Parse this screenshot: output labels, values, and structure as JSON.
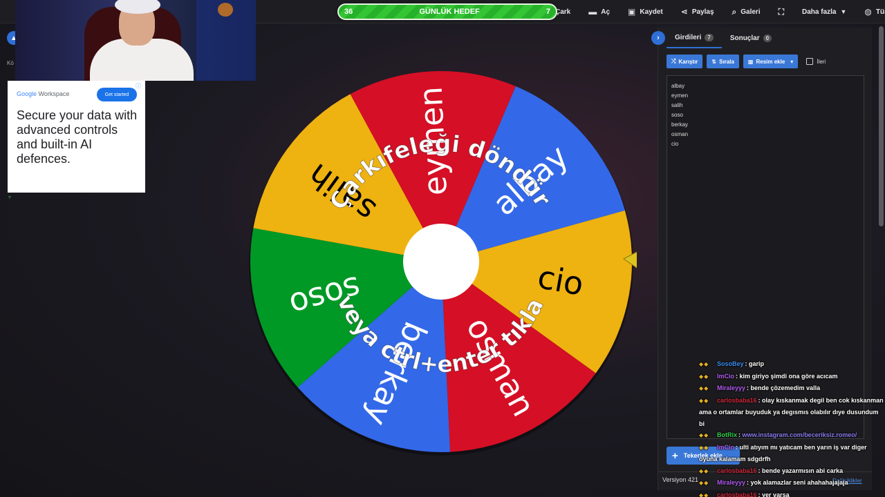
{
  "goal": {
    "left": "36",
    "label": "GÜNLÜK HEDEF",
    "right": "7"
  },
  "nav": [
    {
      "label": "Çark",
      "icon": "wheel-icon",
      "glyph": ""
    },
    {
      "label": "Aç",
      "icon": "folder-icon",
      "glyph": "▬"
    },
    {
      "label": "Kaydet",
      "icon": "save-icon",
      "glyph": "▣"
    },
    {
      "label": "Paylaş",
      "icon": "share-icon",
      "glyph": "⋖"
    },
    {
      "label": "Galeri",
      "icon": "search-icon",
      "glyph": "⌕"
    },
    {
      "label": "",
      "icon": "fullscreen-icon",
      "glyph": "⛶"
    },
    {
      "label": "Daha fazla",
      "icon": "chevron-down-icon",
      "glyph": ""
    },
    {
      "label": "Türkçe",
      "icon": "globe-icon",
      "glyph": "◍"
    }
  ],
  "left_fragment": "Kö",
  "ad": {
    "brand_google": "Google",
    "brand_product": "Workspace",
    "cta": "Get started",
    "headline": "Secure your data with advanced controls and built-in AI defences."
  },
  "wheel": {
    "segments": [
      {
        "label": "albay",
        "color": "#3369e8"
      },
      {
        "label": "cio",
        "color": "#eeb211"
      },
      {
        "label": "osman",
        "color": "#d50f25"
      },
      {
        "label": "berkay",
        "color": "#3369e8"
      },
      {
        "label": "soso",
        "color": "#009925"
      },
      {
        "label": "salih",
        "color": "#eeb211"
      },
      {
        "label": "eymen",
        "color": "#d50f25"
      }
    ],
    "instruction_top": "Çarkıfeleği döndür",
    "instruction_bottom": "veya ctrl+enter tıkla"
  },
  "panel": {
    "tabs": [
      {
        "label": "Girdileri",
        "count": "7"
      },
      {
        "label": "Sonuçlar",
        "count": "0"
      }
    ],
    "buttons": {
      "shuffle": "Karıştır",
      "sort": "Sırala",
      "add_image": "Resim ekle",
      "advanced": "İleri"
    },
    "entries": [
      "albay",
      "eymen",
      "salih",
      "soso",
      "berkay",
      "osman",
      "cio"
    ],
    "add_wheel": "Tekerlek ekle",
    "version": "Versiyon 421",
    "changelog": "Değişiklikler"
  },
  "chat": [
    {
      "user": "SosoBey",
      "color": "#3a8ef0",
      "text": "garip",
      "link": ""
    },
    {
      "user": "ImCio",
      "color": "#b25cf0",
      "text": "kim giriyo şimdi ona göre acıcam",
      "link": ""
    },
    {
      "user": "Miraleyyy",
      "color": "#b25cf0",
      "text": "bende çözemedim valla",
      "link": ""
    },
    {
      "user": "carlosbaba16",
      "color": "#d0283a",
      "text": "olay kıskanmak degil ben cok kıskanman ama o ortamlar buyuduk ya degısmıs olabılır dıye dusundum bi",
      "link": ""
    },
    {
      "user": "BotRix",
      "color": "#33d04a",
      "text": "",
      "link": "www.instagram.com/beceriksiz.romeo/"
    },
    {
      "user": "ImCio",
      "color": "#b25cf0",
      "text": "ulti atıyım mı yatıcam ben yarın iş var diger oyuna kalamam sdgdrfh",
      "link": ""
    },
    {
      "user": "carlosbaba16",
      "color": "#d0283a",
      "text": "bende yazarmısın abi carka",
      "link": ""
    },
    {
      "user": "Miraleyyy",
      "color": "#b25cf0",
      "text": "yok alamazlar seni ahahahajajaja",
      "link": ""
    },
    {
      "user": "carlosbaba16",
      "color": "#d0283a",
      "text": "yer varsa",
      "link": ""
    }
  ]
}
